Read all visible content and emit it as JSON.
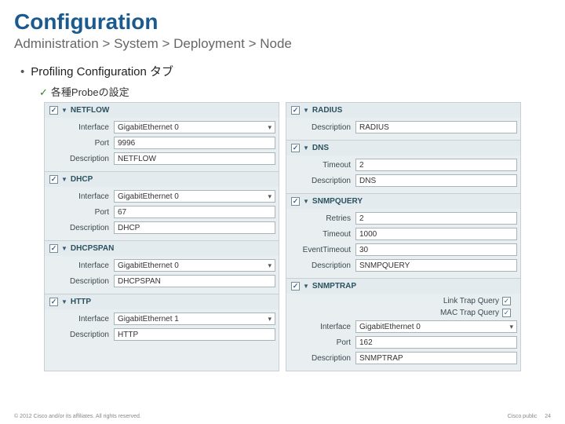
{
  "title": "Configuration",
  "breadcrumb": "Administration > System > Deployment  > Node",
  "bullet": {
    "main": "Profiling Configuration タブ",
    "sub": "各種Probeの設定"
  },
  "left": {
    "s0": {
      "name": "NETFLOW",
      "rows": {
        "r0": {
          "label": "Interface",
          "value": "GigabitEthernet 0",
          "combo": true
        },
        "r1": {
          "label": "Port",
          "value": "9996"
        },
        "r2": {
          "label": "Description",
          "value": "NETFLOW"
        }
      }
    },
    "s1": {
      "name": "DHCP",
      "rows": {
        "r0": {
          "label": "Interface",
          "value": "GigabitEthernet 0",
          "combo": true
        },
        "r1": {
          "label": "Port",
          "value": "67"
        },
        "r2": {
          "label": "Description",
          "value": "DHCP"
        }
      }
    },
    "s2": {
      "name": "DHCPSPAN",
      "rows": {
        "r0": {
          "label": "Interface",
          "value": "GigabitEthernet 0",
          "combo": true
        },
        "r1": {
          "label": "Description",
          "value": "DHCPSPAN"
        }
      }
    },
    "s3": {
      "name": "HTTP",
      "rows": {
        "r0": {
          "label": "Interface",
          "value": "GigabitEthernet 1",
          "combo": true
        },
        "r1": {
          "label": "Description",
          "value": "HTTP"
        }
      }
    }
  },
  "right": {
    "s0": {
      "name": "RADIUS",
      "rows": {
        "r0": {
          "label": "Description",
          "value": "RADIUS"
        }
      }
    },
    "s1": {
      "name": "DNS",
      "rows": {
        "r0": {
          "label": "Timeout",
          "value": "2"
        },
        "r1": {
          "label": "Description",
          "value": "DNS"
        }
      }
    },
    "s2": {
      "name": "SNMPQUERY",
      "rows": {
        "r0": {
          "label": "Retries",
          "value": "2"
        },
        "r1": {
          "label": "Timeout",
          "value": "1000"
        },
        "r2": {
          "label": "EventTimeout",
          "value": "30"
        },
        "r3": {
          "label": "Description",
          "value": "SNMPQUERY"
        }
      }
    },
    "s3": {
      "name": "SNMPTRAP",
      "bools": {
        "b0": "Link Trap Query",
        "b1": "MAC Trap Query"
      },
      "rows": {
        "r0": {
          "label": "Interface",
          "value": "GigabitEthernet 0",
          "combo": true
        },
        "r1": {
          "label": "Port",
          "value": "162"
        },
        "r2": {
          "label": "Description",
          "value": "SNMPTRAP"
        }
      }
    }
  },
  "footer": {
    "left": "© 2012 Cisco and/or its affiliates. All rights reserved.",
    "right": "Cisco public",
    "page": "24"
  }
}
